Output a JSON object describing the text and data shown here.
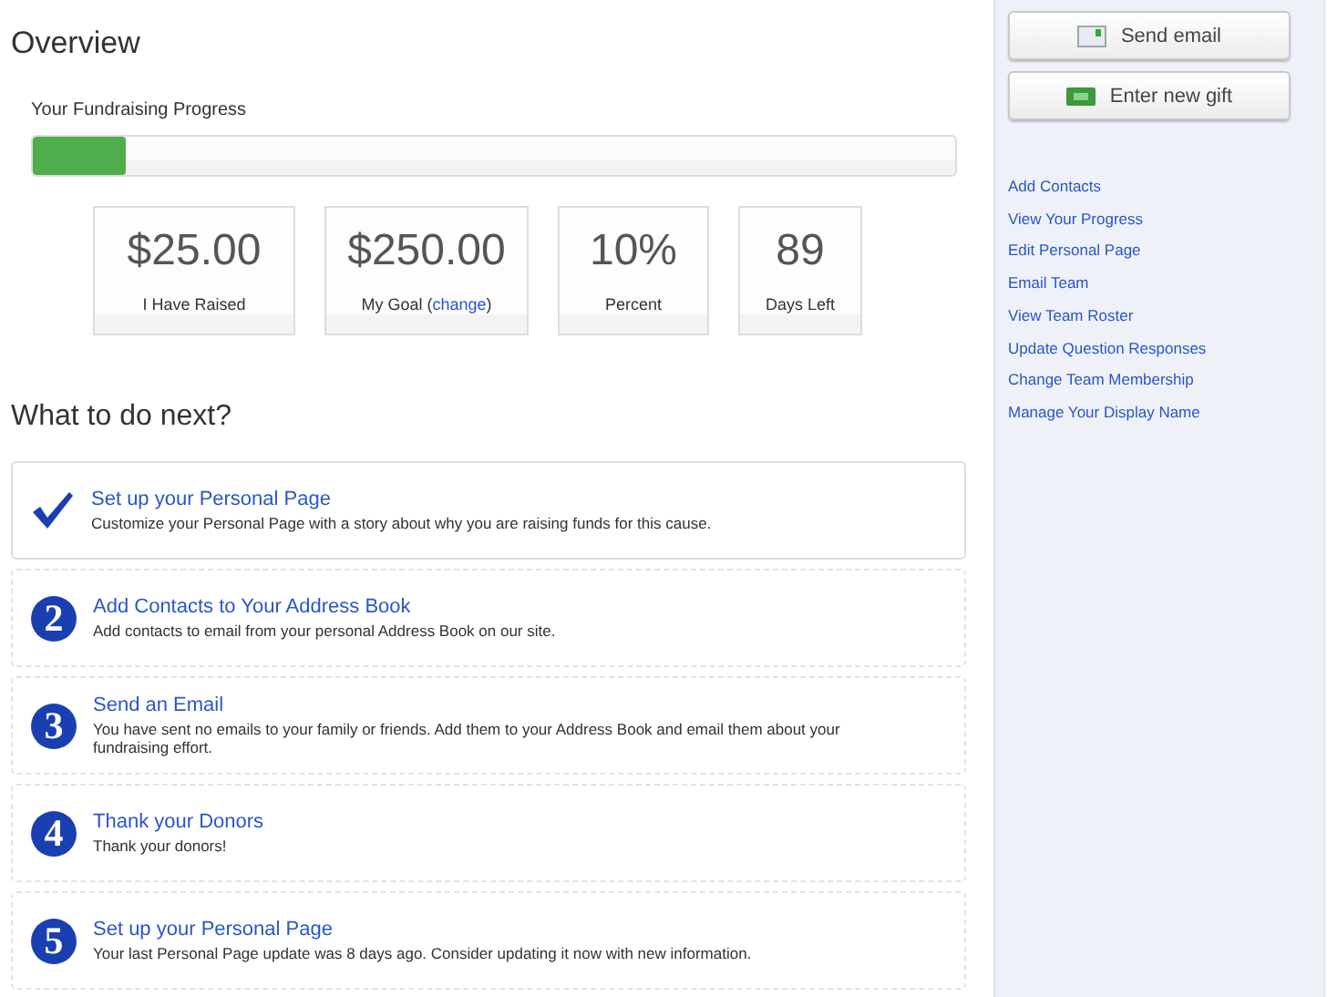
{
  "overview": {
    "title": "Overview",
    "progress_label": "Your Fundraising Progress",
    "level": 0.1,
    "stats": [
      {
        "value": "$25.00",
        "label": "I Have Raised"
      },
      {
        "value": "$250.00",
        "label": "My Goal (",
        "link": "change",
        "label_end": ")"
      },
      {
        "value": "10%",
        "label": "Percent"
      },
      {
        "value": "89",
        "label": "Days Left"
      }
    ]
  },
  "next": {
    "title": "What to do next?",
    "steps": [
      {
        "kind": "check",
        "title": "Set up your Personal Page",
        "text": "Customize your Personal Page with a story about why you are raising funds for this cause."
      },
      {
        "kind": "number",
        "number": "2",
        "title": "Add Contacts to Your Address Book",
        "text": "Add contacts to email from your personal Address Book on our site."
      },
      {
        "kind": "number",
        "number": "3",
        "title": "Send an Email",
        "text": "You have sent no emails to your family or friends. Add them to your Address Book and email them about your fundraising effort."
      },
      {
        "kind": "number",
        "number": "4",
        "title": "Thank your Donors",
        "text": "Thank your donors!"
      },
      {
        "kind": "number",
        "number": "5",
        "title": "Set up your Personal Page",
        "text": "Your last Personal Page update was 8 days ago. Consider updating it now with new information."
      }
    ]
  },
  "sidebar": {
    "buttons": [
      {
        "kind": "email",
        "label": "Send email"
      },
      {
        "kind": "gift",
        "label": "Enter new gift"
      }
    ],
    "links": [
      "Add Contacts",
      "View Your Progress",
      "Edit Personal Page",
      "Email Team",
      "View Team Roster",
      "Update Question Responses",
      "Change Team Membership",
      "Manage Your Display Name"
    ]
  }
}
